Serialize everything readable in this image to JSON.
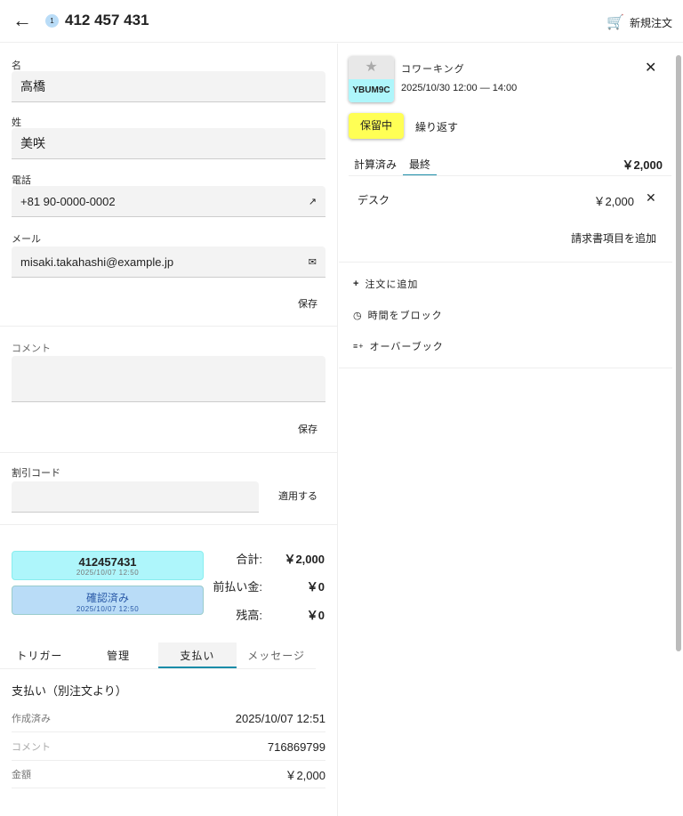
{
  "header": {
    "badge": "1",
    "title": "412 457 431",
    "new_order": "新規注文"
  },
  "form": {
    "first_name_label": "名",
    "first_name": "高橋",
    "last_name_label": "姓",
    "last_name": "美咲",
    "phone_label": "電話",
    "phone": "+81 90-0000-0002",
    "email_label": "メール",
    "email": "misaki.takahashi@example.jp",
    "save": "保存",
    "comment_label": "コメント",
    "comment": "",
    "save2": "保存",
    "discount_label": "割引コード",
    "discount": "",
    "apply": "適用する"
  },
  "summary": {
    "order_card": {
      "number": "412457431",
      "date": "2025/10/07 12:50"
    },
    "status_card": {
      "label": "確認済み",
      "date": "2025/10/07 12:50"
    },
    "total_label": "合計:",
    "total": "￥2,000",
    "prepaid_label": "前払い金:",
    "prepaid": "￥0",
    "balance_label": "残高:",
    "balance": "￥0"
  },
  "tabs": [
    "トリガー",
    "管理",
    "支払い",
    "メッセージ"
  ],
  "payment": {
    "title": "支払い（別注文より）",
    "rows": [
      {
        "label": "作成済み",
        "value": "2025/10/07 12:51"
      },
      {
        "label": "コメント",
        "value": "716869799"
      },
      {
        "label": "金額",
        "value": "￥2,000"
      }
    ]
  },
  "booking": {
    "code": "YBUM9C",
    "name": "コワーキング",
    "time": "2025/10/30 12:00 — 14:00",
    "status": "保留中",
    "repeat": "繰り返す",
    "tab_calc": "計算済み",
    "tab_final": "最終",
    "total": "￥2,000",
    "item_name": "デスク",
    "item_price": "￥2,000",
    "add_invoice": "請求書項目を追加"
  },
  "actions": [
    "注文に追加",
    "時間をブロック",
    "オーバーブック"
  ]
}
